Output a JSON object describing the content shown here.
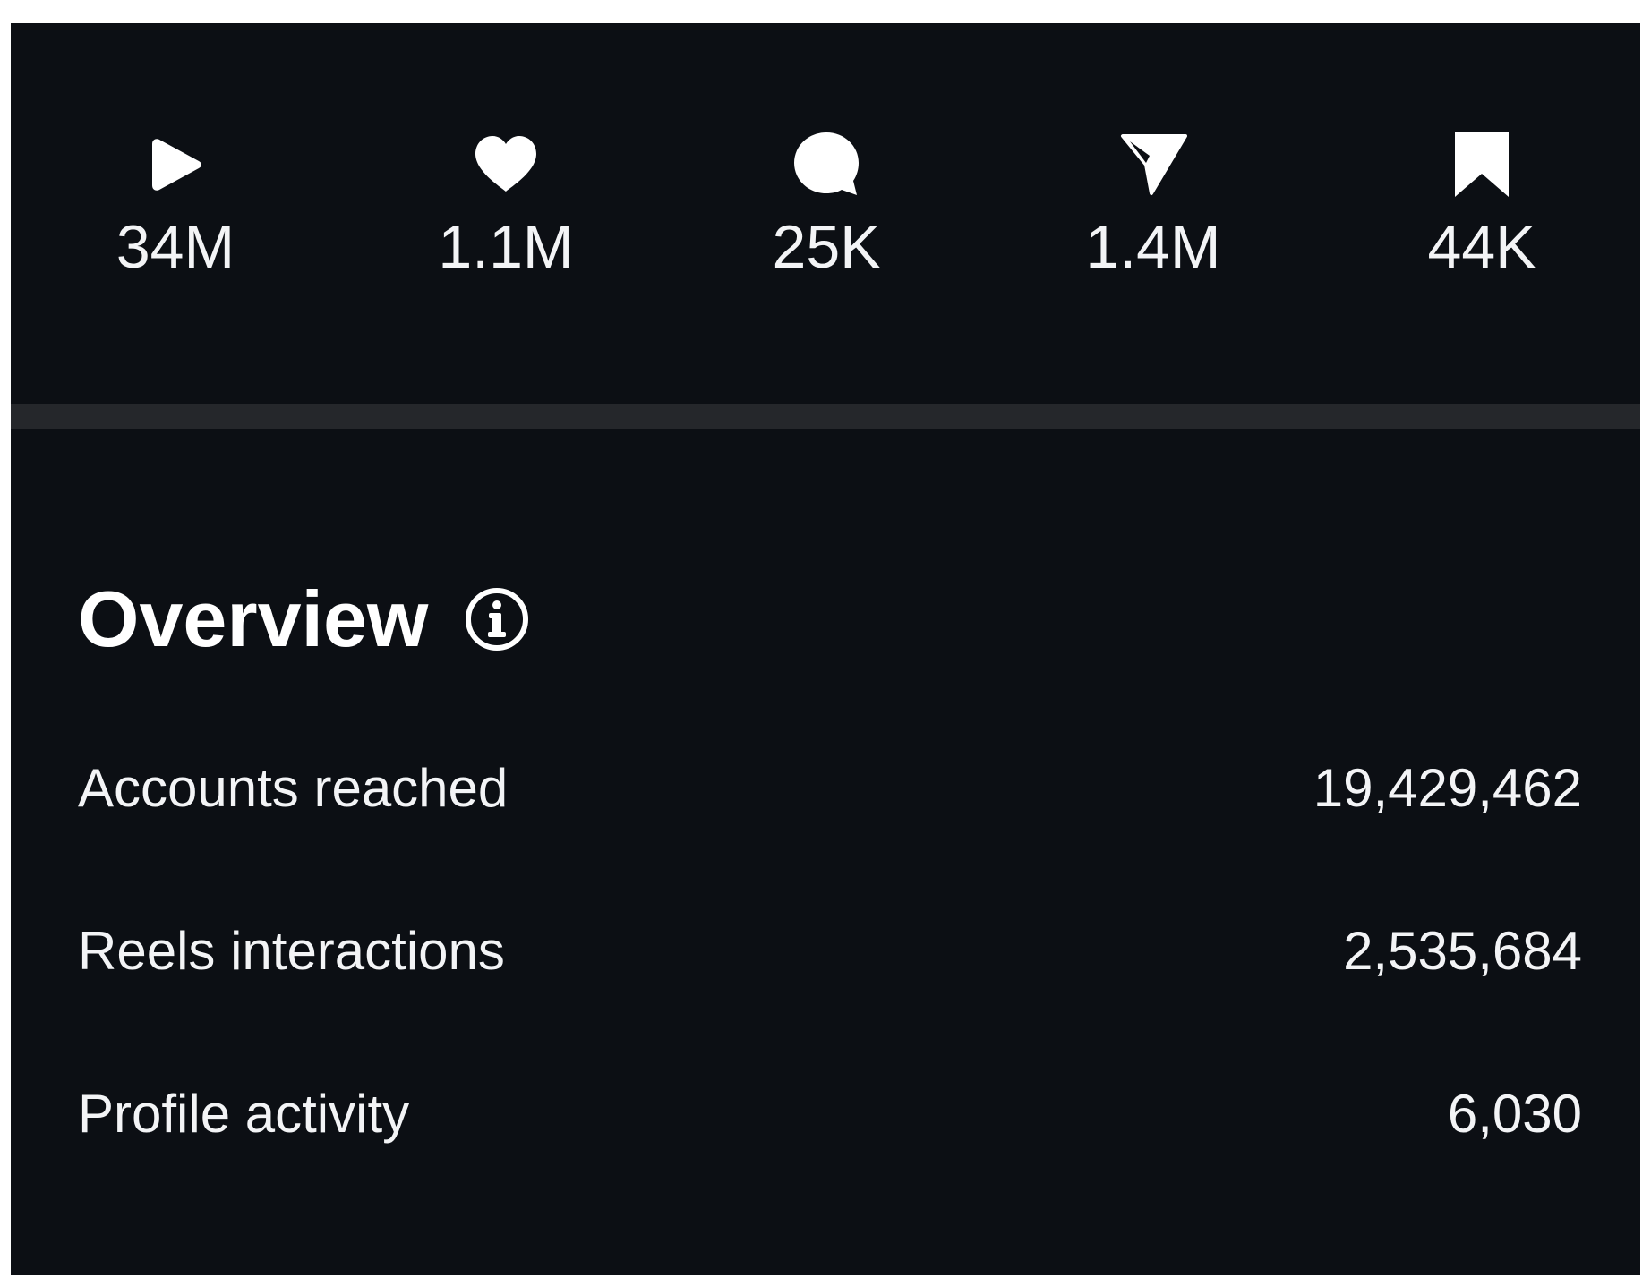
{
  "stats": [
    {
      "icon": "play-icon",
      "value": "34M"
    },
    {
      "icon": "heart-icon",
      "value": "1.1M"
    },
    {
      "icon": "comment-icon",
      "value": "25K"
    },
    {
      "icon": "send-icon",
      "value": "1.4M"
    },
    {
      "icon": "bookmark-icon",
      "value": "44K"
    }
  ],
  "overview": {
    "title": "Overview",
    "info_icon": "info-icon",
    "rows": [
      {
        "label": "Accounts reached",
        "value": "19,429,462"
      },
      {
        "label": "Reels interactions",
        "value": "2,535,684"
      },
      {
        "label": "Profile activity",
        "value": "6,030"
      }
    ]
  },
  "colors": {
    "background": "#0c0f14",
    "divider": "#25272b",
    "text": "#f3f4f6"
  }
}
